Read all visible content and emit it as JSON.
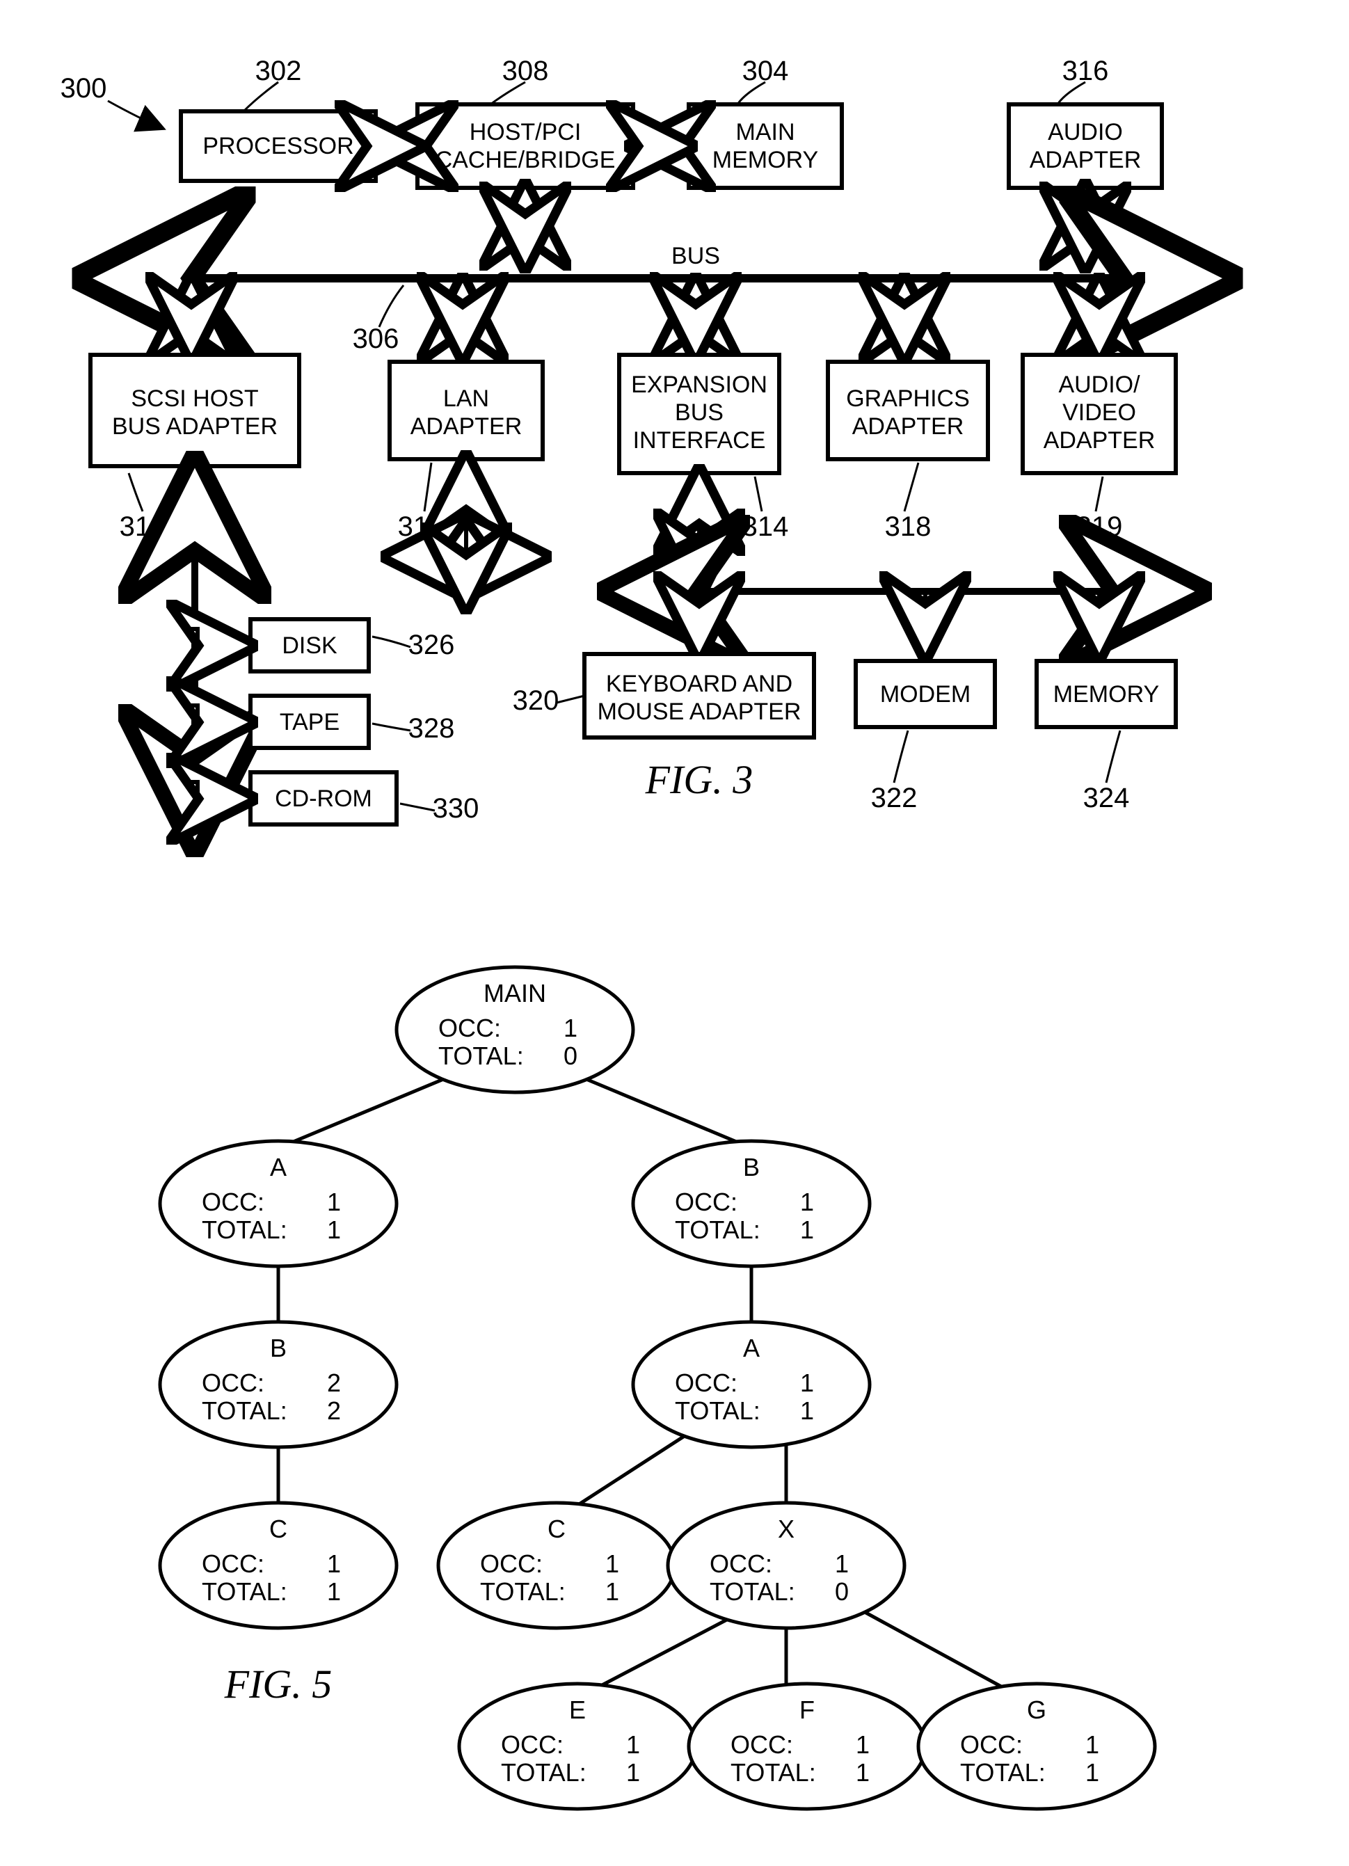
{
  "fig3": {
    "ref_main": "300",
    "bus_label": "BUS",
    "bus_ref": "306",
    "caption": "FIG. 3",
    "blocks": {
      "processor": {
        "label": "PROCESSOR",
        "ref": "302"
      },
      "hostpci": {
        "label1": "HOST/PCI",
        "label2": "CACHE/BRIDGE",
        "ref": "308"
      },
      "mainmem": {
        "label1": "MAIN",
        "label2": "MEMORY",
        "ref": "304"
      },
      "audio": {
        "label1": "AUDIO",
        "label2": "ADAPTER",
        "ref": "316"
      },
      "scsi": {
        "label1": "SCSI HOST",
        "label2": "BUS ADAPTER",
        "ref": "312"
      },
      "lan": {
        "label1": "LAN",
        "label2": "ADAPTER",
        "ref": "310"
      },
      "expbus": {
        "label1": "EXPANSION",
        "label2": "BUS",
        "label3": "INTERFACE",
        "ref": "314"
      },
      "graphics": {
        "label1": "GRAPHICS",
        "label2": "ADAPTER",
        "ref": "318"
      },
      "av": {
        "label1": "AUDIO/",
        "label2": "VIDEO",
        "label3": "ADAPTER",
        "ref": "319"
      },
      "disk": {
        "label": "DISK",
        "ref": "326"
      },
      "tape": {
        "label": "TAPE",
        "ref": "328"
      },
      "cdrom": {
        "label": "CD-ROM",
        "ref": "330"
      },
      "kbm": {
        "label1": "KEYBOARD AND",
        "label2": "MOUSE ADAPTER",
        "ref": "320"
      },
      "modem": {
        "label": "MODEM",
        "ref": "322"
      },
      "memory": {
        "label": "MEMORY",
        "ref": "324"
      }
    }
  },
  "fig5": {
    "caption": "FIG. 5",
    "occ_label": "OCC:",
    "total_label": "TOTAL:",
    "nodes": {
      "main": {
        "name": "MAIN",
        "occ": "1",
        "total": "0"
      },
      "a1": {
        "name": "A",
        "occ": "1",
        "total": "1"
      },
      "b1": {
        "name": "B",
        "occ": "1",
        "total": "1"
      },
      "b2": {
        "name": "B",
        "occ": "2",
        "total": "2"
      },
      "a2": {
        "name": "A",
        "occ": "1",
        "total": "1"
      },
      "c1": {
        "name": "C",
        "occ": "1",
        "total": "1"
      },
      "c2": {
        "name": "C",
        "occ": "1",
        "total": "1"
      },
      "x": {
        "name": "X",
        "occ": "1",
        "total": "0"
      },
      "e": {
        "name": "E",
        "occ": "1",
        "total": "1"
      },
      "f": {
        "name": "F",
        "occ": "1",
        "total": "1"
      },
      "g": {
        "name": "G",
        "occ": "1",
        "total": "1"
      }
    }
  }
}
